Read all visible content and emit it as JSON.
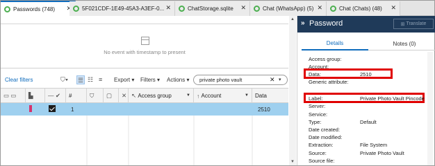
{
  "tabs": [
    {
      "label": "Passwords (748)",
      "active": true
    },
    {
      "label": "5F021CDF-1E49-45A3-A3EF-0..."
    },
    {
      "label": "ChatStorage.sqlite"
    },
    {
      "label": "Chat (WhatsApp) (5)"
    },
    {
      "label": "Chat (Chats) (48)"
    }
  ],
  "timeline": {
    "empty_message": "No event with timestamp to present"
  },
  "toolbar": {
    "clear_filters": "Clear filters",
    "export_label": "Export",
    "filters_label": "Filters",
    "actions_label": "Actions",
    "search_value": "private photo vault"
  },
  "grid": {
    "columns": {
      "number": "#",
      "access_group": "Access group",
      "account": "Account",
      "data": "Data"
    },
    "rows": [
      {
        "number": "1",
        "data": "2510",
        "checked": true
      }
    ]
  },
  "details": {
    "title": "Password",
    "translate_label": "Translate",
    "tabs": [
      {
        "label": "Details",
        "active": true
      },
      {
        "label": "Notes (0)"
      }
    ],
    "properties": [
      {
        "label": "Access group:",
        "value": ""
      },
      {
        "label": "Account:",
        "value": ""
      },
      {
        "label": "Data:",
        "value": "2510"
      },
      {
        "label": "Generic attribute:",
        "value": ""
      },
      {
        "label": "Label:",
        "value": "Private Photo Vault Pincode"
      },
      {
        "label": "Server:",
        "value": ""
      },
      {
        "label": "Service:",
        "value": ""
      },
      {
        "label": "Type:",
        "value": "Default"
      },
      {
        "label": "Date created:",
        "value": ""
      },
      {
        "label": "Date modified:",
        "value": ""
      },
      {
        "label": "Extraction:",
        "value": "File System"
      },
      {
        "label": "Source:",
        "value": "Private Photo Vault"
      },
      {
        "label": "Source file:",
        "value": ""
      }
    ]
  },
  "colors": {
    "accent": "#0f6cbd",
    "header_bg": "#1f3a59",
    "selected_row": "#9fd0ef",
    "highlight": "#e00000",
    "tab_status": "#4caf50"
  }
}
